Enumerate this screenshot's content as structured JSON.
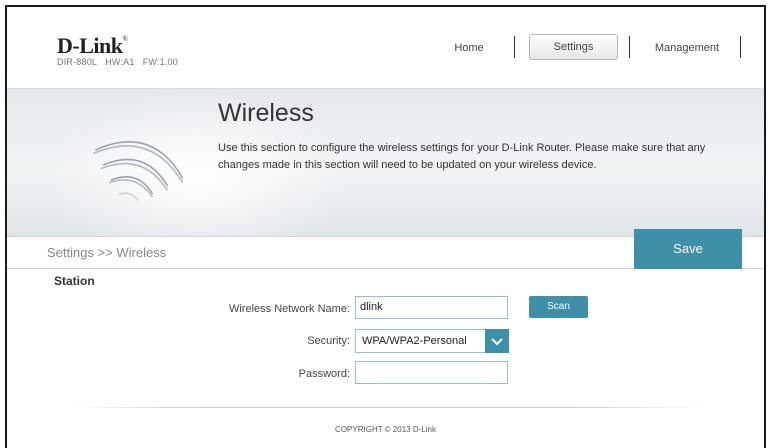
{
  "brand": {
    "logo_text": "D-Link",
    "logo_mark": "®",
    "model": "DIR-880L",
    "hw": "HW:A1",
    "fw": "FW:1.00"
  },
  "nav": {
    "home": "Home",
    "settings": "Settings",
    "management": "Management"
  },
  "banner": {
    "title": "Wireless",
    "description": "Use this section to configure the wireless settings for your D-Link Router. Please make sure that any changes made in this section will need to be updated on your wireless device."
  },
  "breadcrumb": "Settings >> Wireless",
  "save_label": "Save",
  "section": {
    "title": "Station",
    "network_name_label": "Wireless Network Name:",
    "network_name_value": "dlink",
    "scan_label": "Scan",
    "security_label": "Security:",
    "security_value": "WPA/WPA2-Personal",
    "password_label": "Password:",
    "password_value": ""
  },
  "footer": {
    "copyright": "COPYRIGHT © 2013 D-Link"
  },
  "colors": {
    "accent": "#3e8fa8",
    "field_border": "#8bc3cf"
  }
}
